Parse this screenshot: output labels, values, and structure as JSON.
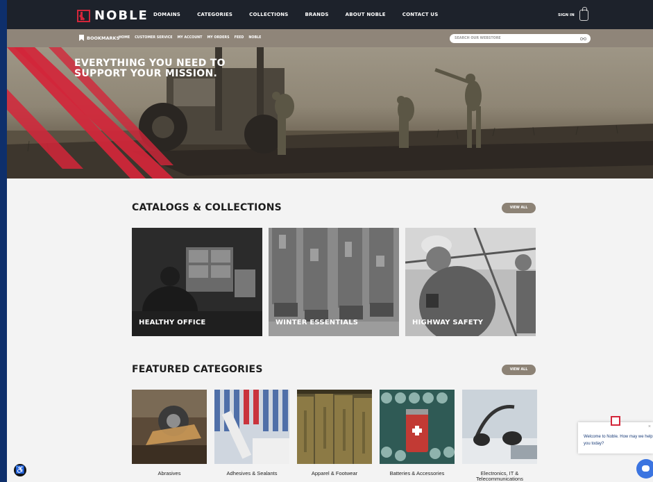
{
  "header": {
    "brand": "NOBLE",
    "nav": [
      "DOMAINS",
      "CATEGORIES",
      "COLLECTIONS",
      "BRANDS",
      "ABOUT NOBLE",
      "CONTACT US"
    ],
    "sign_in": "SIGN IN"
  },
  "subbar": {
    "bookmarks": "BOOKMARKS",
    "links": [
      "HOME",
      "CUSTOMER SERVICE",
      "MY ACCOUNT",
      "MY ORDERS",
      "FEED",
      "NOBLE"
    ],
    "search_placeholder": "SEARCH OUR WEBSTORE"
  },
  "hero": {
    "line1": "EVERYTHING YOU NEED TO",
    "line2": "SUPPORT YOUR MISSION."
  },
  "catalogs": {
    "title": "CATALOGS & COLLECTIONS",
    "view_all": "VIEW ALL",
    "cards": [
      "HEALTHY OFFICE",
      "WINTER ESSENTIALS",
      "HIGHWAY SAFETY"
    ]
  },
  "featured": {
    "title": "FEATURED CATEGORIES",
    "view_all": "VIEW ALL",
    "items": [
      "Abrasives",
      "Adhesives & Sealants",
      "Apparel & Footwear",
      "Batteries & Accessories",
      "Electronics, IT & Telecommunications"
    ]
  },
  "chat": {
    "message": "Welcome to Noble. How may we help you today?",
    "close": "×"
  },
  "colors": {
    "brand_red": "#d3263a",
    "nav_dark": "#1d222b",
    "tan": "#8f8579"
  }
}
